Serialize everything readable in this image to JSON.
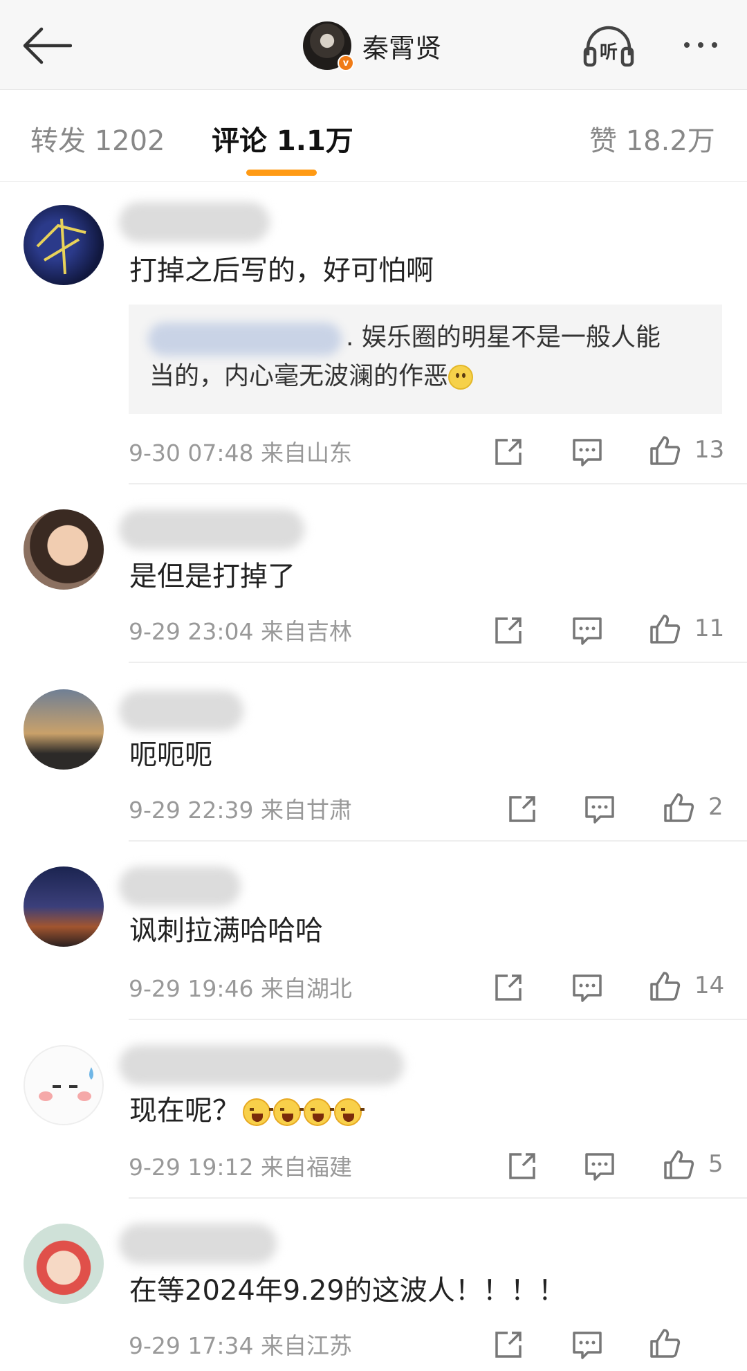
{
  "header": {
    "title": "秦霄贤",
    "verified_badge": "v",
    "listen_label": "听",
    "icons": [
      "back-arrow-icon",
      "headphones-icon",
      "more-icon"
    ]
  },
  "tabs": [
    {
      "label": "转发 1202",
      "active": false
    },
    {
      "label": "评论 1.1万",
      "active": true
    },
    {
      "label": "赞 18.2万",
      "active": false
    }
  ],
  "accent_color": "#ff9a14",
  "comments": [
    {
      "text": "打掉之后写的，好可怕啊",
      "reply": {
        "line1": ". 娱乐圈的明星不是一般人能",
        "line2": "当的，内心毫无波澜的作恶"
      },
      "time": "9-30 07:48",
      "location": "来自山东",
      "likes": "13"
    },
    {
      "text": "是但是打掉了",
      "time": "9-29 23:04",
      "location": "来自吉林",
      "likes": "11"
    },
    {
      "text": "呃呃呃",
      "time": "9-29 22:39",
      "location": "来自甘肃",
      "likes": "2"
    },
    {
      "text": "讽刺拉满哈哈哈",
      "time": "9-29 19:46",
      "location": "来自湖北",
      "likes": "14"
    },
    {
      "text": "现在呢？",
      "time": "9-29 19:12",
      "location": "来自福建",
      "likes": "5"
    },
    {
      "text": "在等2024年9.29的这波人！！！！",
      "time": "9-29 17:34",
      "location": "来自江苏",
      "likes": ""
    }
  ]
}
